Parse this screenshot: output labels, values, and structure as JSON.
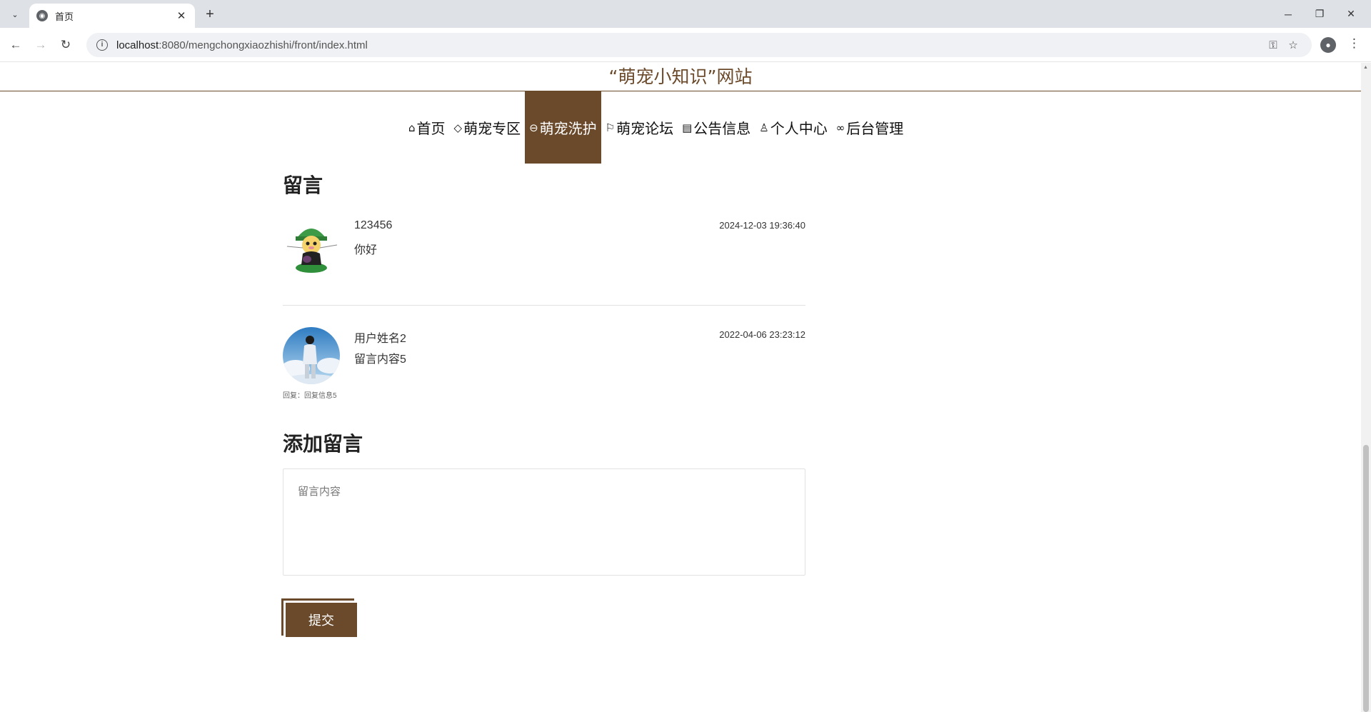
{
  "browser": {
    "tab_title": "首页",
    "url_host": "localhost",
    "url_rest": ":8080/mengchongxiaozhishi/front/index.html",
    "new_tab": "+",
    "close_tab": "✕"
  },
  "site": {
    "title": "“萌宠小知识”网站",
    "nav": [
      {
        "label": "首页",
        "icon": "home-icon"
      },
      {
        "label": "萌宠专区",
        "icon": "tag-icon"
      },
      {
        "label": "萌宠洗护",
        "icon": "bath-icon",
        "active": true
      },
      {
        "label": "萌宠论坛",
        "icon": "flag-icon"
      },
      {
        "label": "公告信息",
        "icon": "clipboard-icon"
      },
      {
        "label": "个人中心",
        "icon": "user-icon"
      },
      {
        "label": "后台管理",
        "icon": "link-icon"
      }
    ]
  },
  "messages": {
    "title": "留言",
    "items": [
      {
        "username": "123456",
        "content": "你好",
        "time": "2024-12-03 19:36:40",
        "reply": ""
      },
      {
        "username": "用户姓名2",
        "content": "留言内容5",
        "time": "2022-04-06 23:23:12",
        "reply": "回复：回复信息5"
      }
    ]
  },
  "add_message": {
    "title": "添加留言",
    "placeholder": "留言内容",
    "submit_label": "提交"
  },
  "colors": {
    "brand": "#6b4a2b"
  }
}
